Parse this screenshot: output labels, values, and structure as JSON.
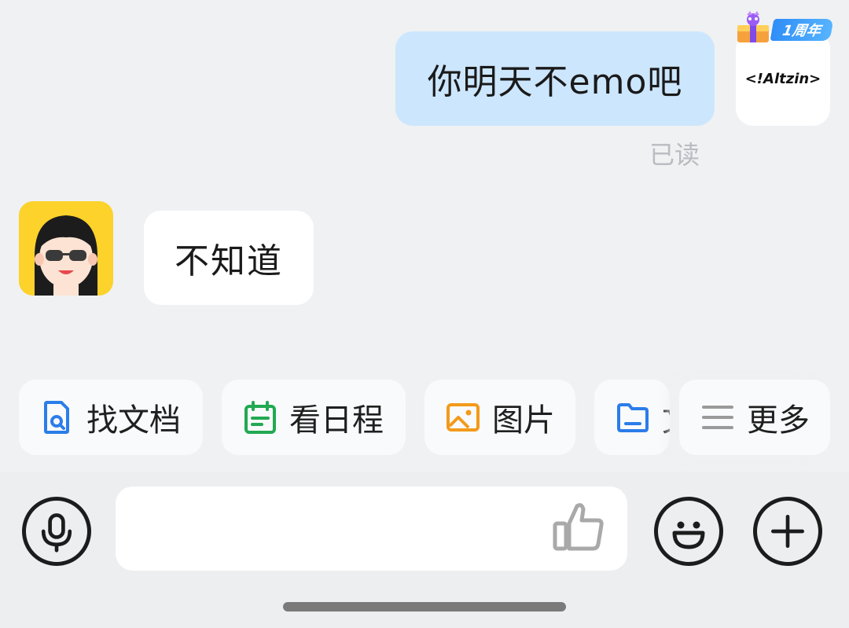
{
  "messages": {
    "outgoing": {
      "text": "你明天不emo吧",
      "status": "已读"
    },
    "incoming": {
      "text": "不知道"
    }
  },
  "self_avatar": {
    "text": "<!Altzin>",
    "badge": "1周年"
  },
  "peer_avatar": {
    "icon": "cartoon-face-sunglasses",
    "bg_color": "#fcd22b"
  },
  "quick_actions": [
    {
      "label": "找文档",
      "icon": "doc-search-icon",
      "color": "#2b7de9"
    },
    {
      "label": "看日程",
      "icon": "calendar-icon",
      "color": "#22a952"
    },
    {
      "label": "图片",
      "icon": "image-icon",
      "color": "#f39a1b"
    },
    {
      "label": "文件",
      "icon": "folder-icon",
      "color": "#2b7de9"
    },
    {
      "label": "更多",
      "icon": "menu-lines-icon",
      "color": "#9a9a9a"
    }
  ],
  "input_bar": {
    "placeholder": "",
    "voice_icon": "microphone-icon",
    "like_icon": "thumbs-up-icon",
    "emoji_icon": "smiley-icon",
    "plus_icon": "plus-icon"
  },
  "colors": {
    "outgoing_bubble": "#cce6fd",
    "incoming_bubble": "#ffffff",
    "background": "#eff1f3"
  }
}
